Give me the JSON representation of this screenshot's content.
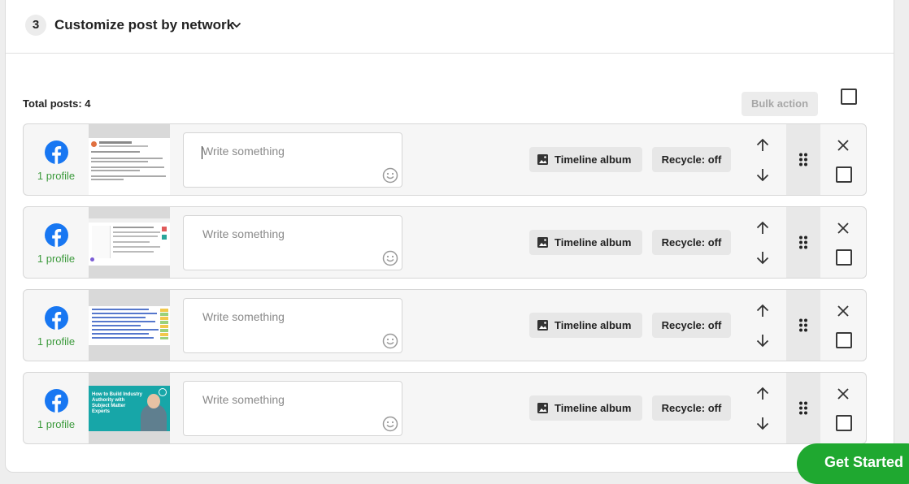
{
  "header": {
    "step_number": "3",
    "title": "Customize post by network"
  },
  "summary": {
    "total_label": "Total posts: 4"
  },
  "toolbar": {
    "bulk_action_label": "Bulk action"
  },
  "posts": [
    {
      "network_icon": "facebook-icon",
      "profile_label": "1 profile",
      "placeholder": "Write something",
      "timeline_label": "Timeline album",
      "recycle_label": "Recycle: off"
    },
    {
      "network_icon": "facebook-icon",
      "profile_label": "1 profile",
      "placeholder": "Write something",
      "timeline_label": "Timeline album",
      "recycle_label": "Recycle: off"
    },
    {
      "network_icon": "facebook-icon",
      "profile_label": "1 profile",
      "placeholder": "Write something",
      "timeline_label": "Timeline album",
      "recycle_label": "Recycle: off"
    },
    {
      "network_icon": "facebook-icon",
      "profile_label": "1 profile",
      "placeholder": "Write something",
      "timeline_label": "Timeline album",
      "recycle_label": "Recycle: off",
      "thumbnail_text": "How to Build Industry Authority with Subject Matter Experts"
    }
  ],
  "cta": {
    "label": "Get Started"
  },
  "colors": {
    "facebook": "#1877f2",
    "profile_green": "#3c9a3c",
    "cta_green": "#1fa830",
    "thumb_teal": "#17a6a8"
  }
}
